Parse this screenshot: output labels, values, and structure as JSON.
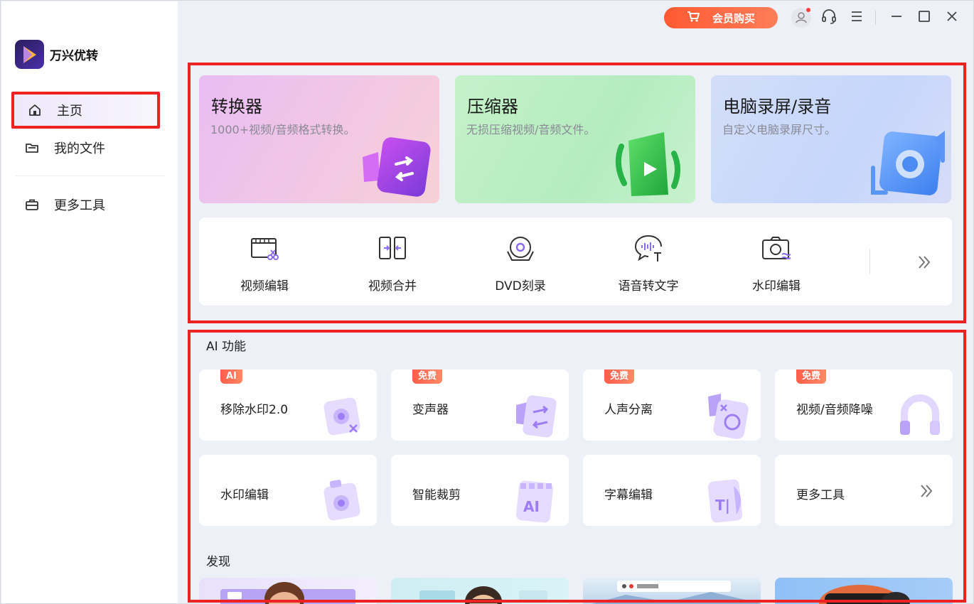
{
  "app": {
    "name": "万兴优转"
  },
  "sidebar": {
    "items": [
      {
        "label": "主页",
        "icon": "home-icon",
        "active": true
      },
      {
        "label": "我的文件",
        "icon": "folder-icon"
      },
      {
        "label": "更多工具",
        "icon": "toolbox-icon"
      }
    ]
  },
  "titlebar": {
    "vip_label": "会员购买",
    "icons": [
      "cart-icon",
      "user-avatar-icon",
      "headset-icon",
      "menu-icon",
      "minimize-icon",
      "maximize-icon",
      "close-icon"
    ]
  },
  "features": [
    {
      "title": "转换器",
      "desc": "1000+视频/音频格式转换。",
      "icon": "converter-icon"
    },
    {
      "title": "压缩器",
      "desc": "无损压缩视频/音频文件。",
      "icon": "compressor-icon"
    },
    {
      "title": "电脑录屏/录音",
      "desc": "自定义电脑录屏尺寸。",
      "icon": "screen-recorder-icon"
    }
  ],
  "tools": [
    {
      "label": "视频编辑",
      "icon": "video-edit-icon"
    },
    {
      "label": "视频合并",
      "icon": "video-merge-icon"
    },
    {
      "label": "DVD刻录",
      "icon": "dvd-burn-icon"
    },
    {
      "label": "语音转文字",
      "icon": "speech-to-text-icon"
    },
    {
      "label": "水印编辑",
      "icon": "watermark-icon"
    }
  ],
  "ai_section": {
    "title": "AI 功能",
    "cards": [
      {
        "label": "移除水印2.0",
        "badge": "AI"
      },
      {
        "label": "变声器",
        "badge": "免费"
      },
      {
        "label": "人声分离",
        "badge": "免费"
      },
      {
        "label": "视频/音频降噪",
        "badge": "免费"
      },
      {
        "label": "水印编辑",
        "badge": ""
      },
      {
        "label": "智能裁剪",
        "badge": ""
      },
      {
        "label": "字幕编辑",
        "badge": ""
      },
      {
        "label": "更多工具",
        "badge": ""
      }
    ]
  },
  "discover": {
    "title": "发现"
  },
  "colors": {
    "accent": "#ee2222",
    "vip": "#ff5a32",
    "badge": "#ff6a50",
    "purple": "#8b6cf0"
  }
}
